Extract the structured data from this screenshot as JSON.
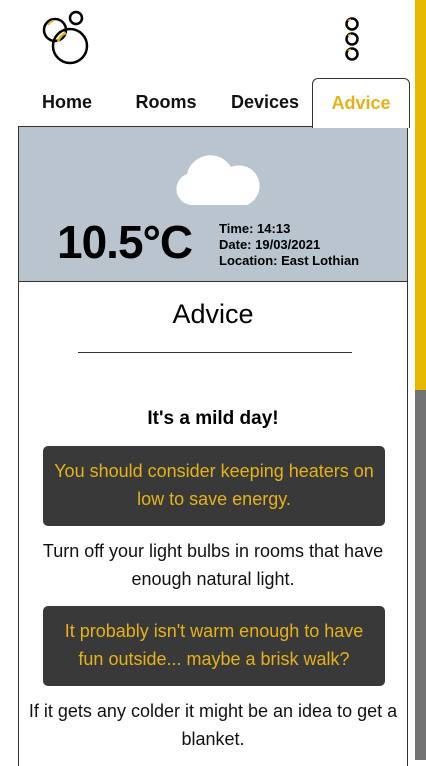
{
  "header": {
    "logo_icon": "bubbles-logo-icon",
    "menu_icon": "three-circles-menu-icon"
  },
  "tabs": [
    {
      "label": "Home",
      "active": false
    },
    {
      "label": "Rooms",
      "active": false
    },
    {
      "label": "Devices",
      "active": false
    },
    {
      "label": "Advice",
      "active": true
    }
  ],
  "weather": {
    "icon": "cloud-icon",
    "temperature": "10.5°C",
    "time": "Time: 14:13",
    "date": "Date: 19/03/2021",
    "location": "Location: East Lothian"
  },
  "advice": {
    "title": "Advice",
    "headline": "It's a mild day!",
    "tip1": "You should consider keeping heaters on low to save energy.",
    "text1": "Turn off your light bulbs in rooms that have enough natural light.",
    "tip2": "It probably isn't warm enough to have fun outside... maybe a brisk walk?",
    "text2": "If it gets any colder it might be an idea to get a blanket."
  },
  "colors": {
    "accent": "#e6b219",
    "weather_bg": "#b9c4cf",
    "tip_bg": "#393939",
    "scrollbar": "#727272",
    "scroll_thumb": "#e6b800"
  },
  "scroll": {
    "thumb_fraction": 0.51
  }
}
